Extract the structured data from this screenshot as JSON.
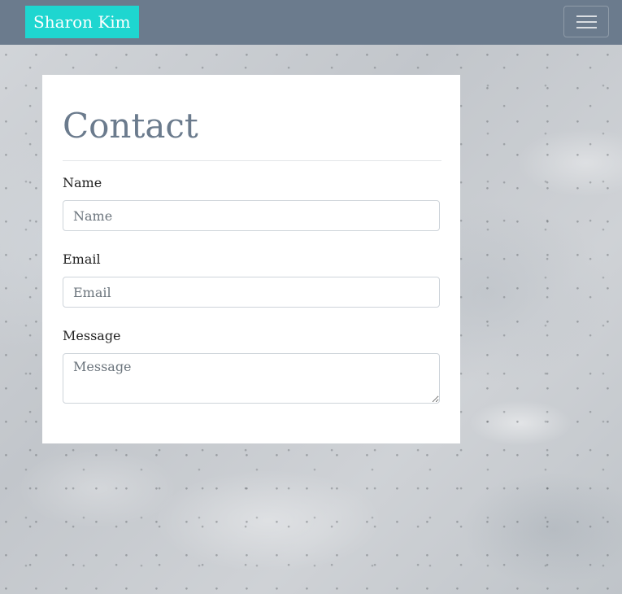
{
  "navbar": {
    "brand": "Sharon Kim",
    "toggler_icon": "hamburger-menu-icon",
    "background_color": "#6b7b8d",
    "brand_color": "#1ed6d0"
  },
  "contact": {
    "title": "Contact",
    "name_label": "Name",
    "name_placeholder": "Name",
    "name_value": "",
    "email_label": "Email",
    "email_placeholder": "Email",
    "email_value": "",
    "message_label": "Message",
    "message_placeholder": "Message",
    "message_value": ""
  }
}
